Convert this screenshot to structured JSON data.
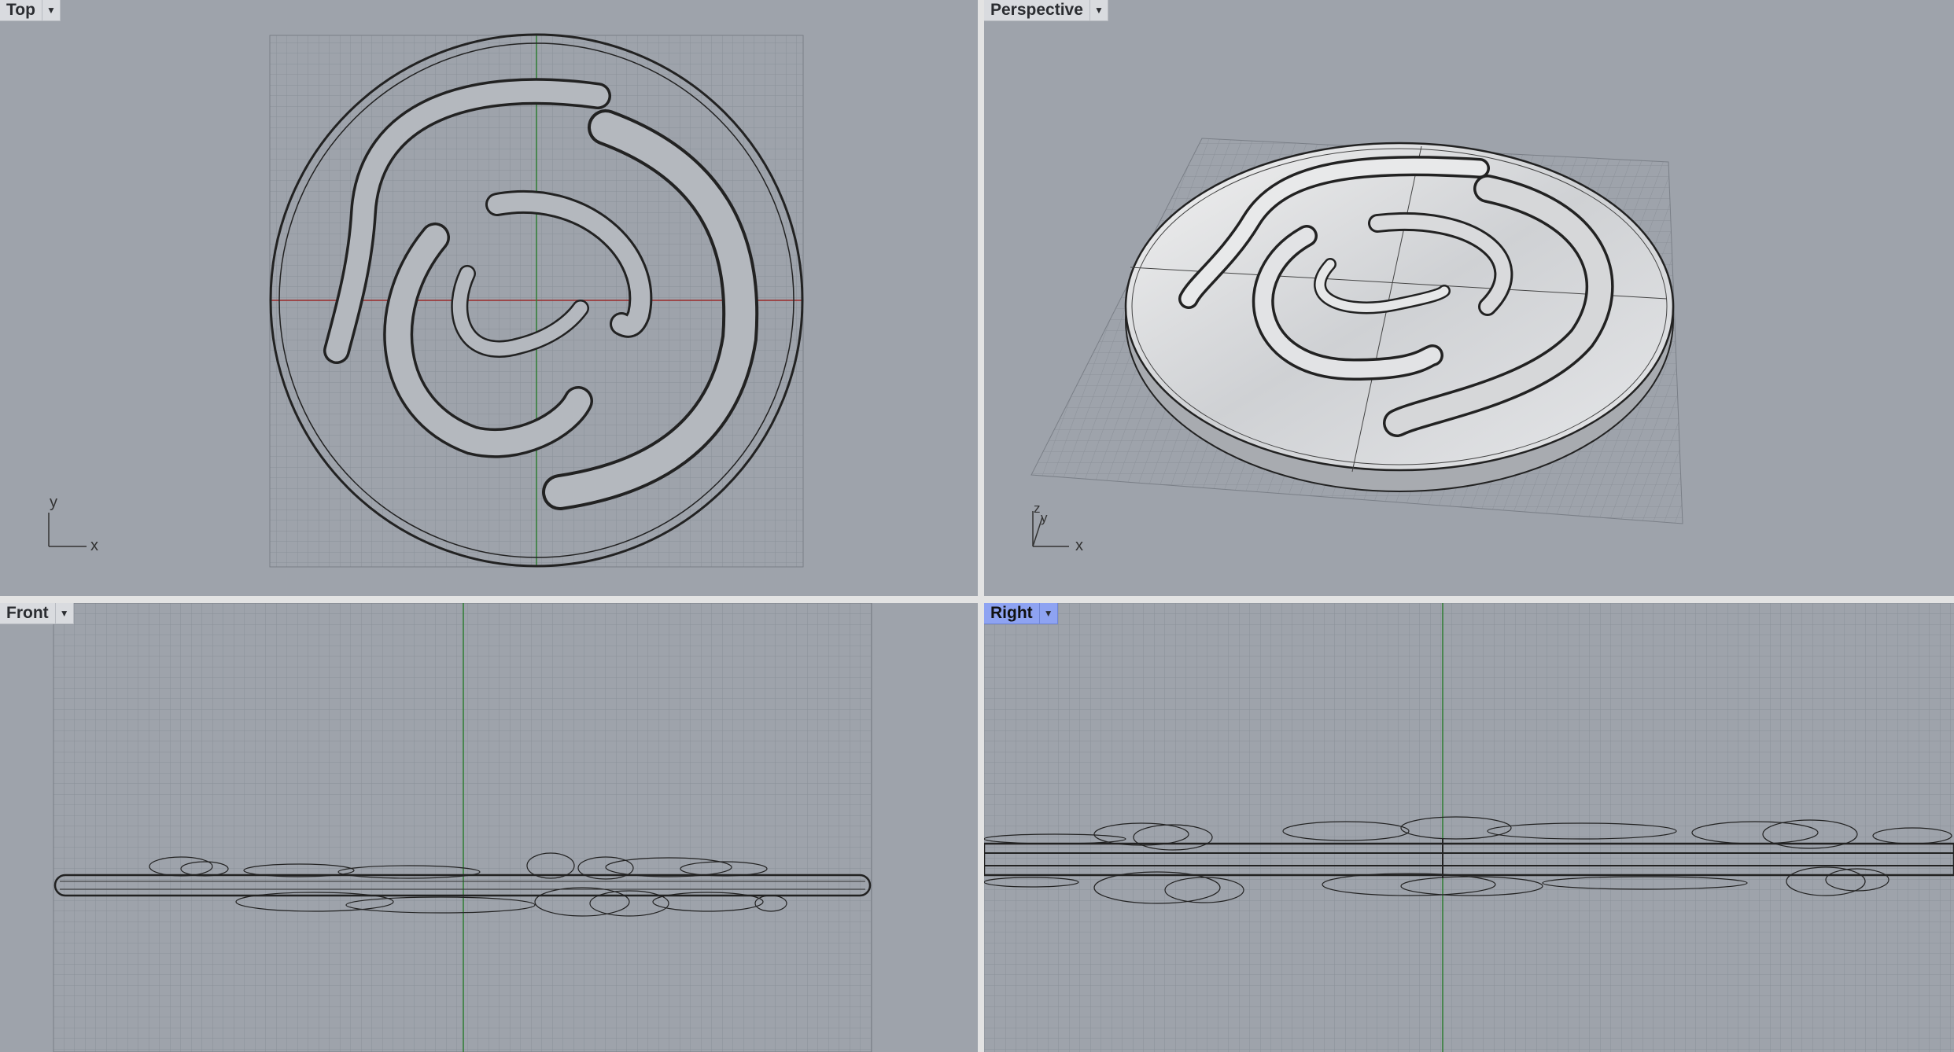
{
  "viewports": {
    "top": {
      "label": "Top",
      "axis": {
        "v": "y",
        "h": "x"
      }
    },
    "perspective": {
      "label": "Perspective",
      "axis": {
        "v": "z",
        "v2": "y",
        "h": "x"
      }
    },
    "front": {
      "label": "Front"
    },
    "right": {
      "label": "Right",
      "active": true
    }
  },
  "colors": {
    "viewport_bg": "#9ea3ab",
    "grid_minor": "#8b9098",
    "grid_major": "#7a7f87",
    "x_axis": "#9b2a2a",
    "y_axis": "#2e7d32",
    "active_tab": "#8ea3f2"
  },
  "icons": {
    "viewport_menu": "chevron-down-icon"
  }
}
